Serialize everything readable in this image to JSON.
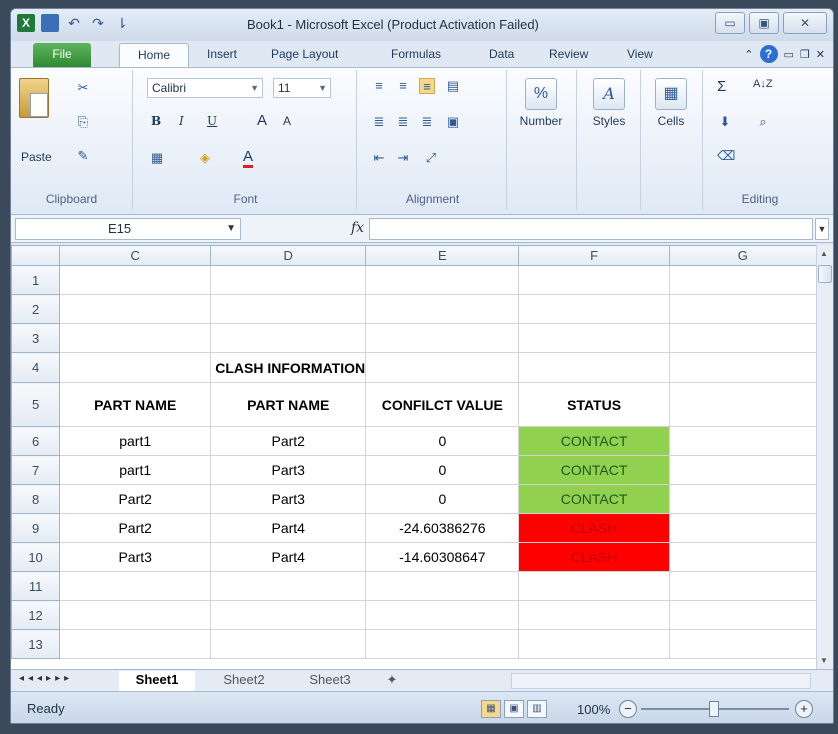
{
  "window": {
    "title": "Book1  -  Microsoft Excel (Product Activation Failed)",
    "controls": {
      "minimize": "▭",
      "maximize": "▣",
      "close": "✕"
    }
  },
  "quick_access": {
    "logo": "X",
    "save_icon": "save-icon",
    "undo": "↶",
    "redo": "↷",
    "customize": "⇂"
  },
  "tabs": {
    "file": "File",
    "home": "Home",
    "insert": "Insert",
    "page_layout": "Page Layout",
    "formulas": "Formulas",
    "data": "Data",
    "review": "Review",
    "view": "View"
  },
  "ribbon": {
    "clipboard": {
      "label": "Clipboard",
      "paste": "Paste"
    },
    "font": {
      "label": "Font",
      "family": "Calibri",
      "size": "11",
      "bold": "B",
      "italic": "I",
      "underline": "U",
      "grow": "A",
      "shrink": "A",
      "font_color": "A"
    },
    "alignment": {
      "label": "Alignment"
    },
    "number": {
      "label": "Number",
      "percent": "%"
    },
    "styles": {
      "label": "Styles",
      "icon": "A"
    },
    "cells": {
      "label": "Cells"
    },
    "editing": {
      "label": "Editing",
      "sum": "Σ",
      "sort": "A↓Z"
    }
  },
  "formula_bar": {
    "name_box": "E15",
    "fx": "fx",
    "content": ""
  },
  "sheet": {
    "columns": [
      "C",
      "D",
      "E",
      "F",
      "G"
    ],
    "rows": [
      {
        "num": "1",
        "cells": [
          "",
          "",
          "",
          "",
          ""
        ]
      },
      {
        "num": "2",
        "cells": [
          "",
          "",
          "",
          "",
          ""
        ]
      },
      {
        "num": "3",
        "cells": [
          "",
          "",
          "",
          "",
          ""
        ]
      },
      {
        "num": "4",
        "cells": [
          "",
          "CLASH INFORMATION",
          "",
          "",
          ""
        ]
      },
      {
        "num": "5",
        "cells": [
          "PART NAME",
          "PART NAME",
          "CONFILCT VALUE",
          "STATUS",
          ""
        ]
      },
      {
        "num": "6",
        "cells": [
          "part1",
          "Part2",
          "0",
          "CONTACT",
          ""
        ]
      },
      {
        "num": "7",
        "cells": [
          "part1",
          "Part3",
          "0",
          "CONTACT",
          ""
        ]
      },
      {
        "num": "8",
        "cells": [
          "Part2",
          "Part3",
          "0",
          "CONTACT",
          ""
        ]
      },
      {
        "num": "9",
        "cells": [
          "Part2",
          "Part4",
          "-24.60386276",
          "CLASH",
          ""
        ]
      },
      {
        "num": "10",
        "cells": [
          "Part3",
          "Part4",
          "-14.60308647",
          "CLASH",
          ""
        ]
      },
      {
        "num": "11",
        "cells": [
          "",
          "",
          "",
          "",
          ""
        ]
      },
      {
        "num": "12",
        "cells": [
          "",
          "",
          "",
          "",
          ""
        ]
      },
      {
        "num": "13",
        "cells": [
          "",
          "",
          "",
          "",
          ""
        ]
      }
    ],
    "colors": {
      "contact": "#92d050",
      "clash": "#ff0000"
    }
  },
  "sheet_tabs": [
    "Sheet1",
    "Sheet2",
    "Sheet3"
  ],
  "status": {
    "ready": "Ready",
    "zoom": "100%",
    "zoom_minus": "−",
    "zoom_plus": "+"
  }
}
